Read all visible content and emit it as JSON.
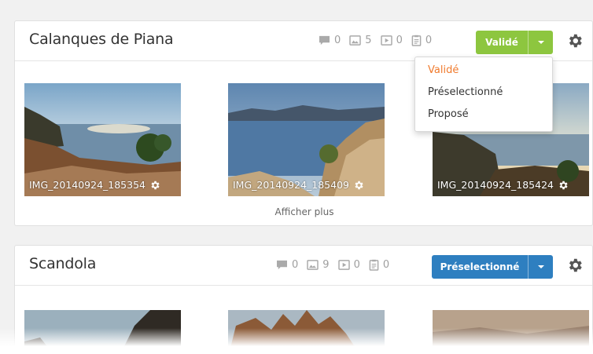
{
  "colors": {
    "accent_green": "#8dc63f",
    "accent_blue": "#2e7fc0",
    "active_orange": "#f07b2e"
  },
  "cards": [
    {
      "title": "Calanques de Piana",
      "stats": {
        "comments": "0",
        "images": "5",
        "videos": "0",
        "documents": "0"
      },
      "status_button": {
        "label": "Validé",
        "color": "green"
      },
      "thumbnails": [
        {
          "caption": "IMG_20140924_185354"
        },
        {
          "caption": "IMG_20140924_185409"
        },
        {
          "caption": "IMG_20140924_185424"
        }
      ],
      "show_more": "Afficher plus"
    },
    {
      "title": "Scandola",
      "stats": {
        "comments": "0",
        "images": "9",
        "videos": "0",
        "documents": "0"
      },
      "status_button": {
        "label": "Préselectionné",
        "color": "blue"
      }
    }
  ],
  "dropdown": {
    "items": [
      {
        "label": "Validé",
        "active": true
      },
      {
        "label": "Préselectionné",
        "active": false
      },
      {
        "label": "Proposé",
        "active": false
      }
    ]
  },
  "icons": [
    "comment-icon",
    "image-icon",
    "video-icon",
    "document-icon",
    "caret-down-icon",
    "gear-icon"
  ]
}
